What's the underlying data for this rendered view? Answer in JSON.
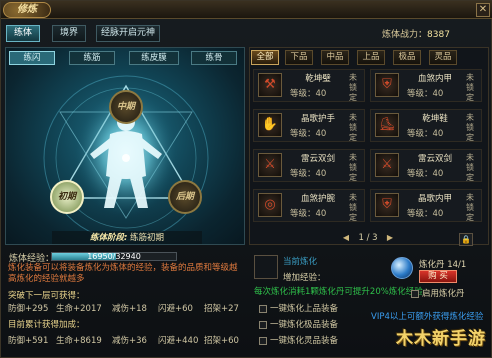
{
  "window": {
    "title": "修炼",
    "close_label": "✕"
  },
  "tabs": [
    {
      "label": "练体",
      "active": true
    },
    {
      "label": "境界",
      "active": false
    },
    {
      "label": "经脉开启元神",
      "active": false
    }
  ],
  "power": {
    "label": "炼体战力：",
    "value": "8387"
  },
  "subtabs": [
    {
      "label": "练闪",
      "active": true
    },
    {
      "label": "练筋",
      "active": false
    },
    {
      "label": "练皮膜",
      "active": false
    },
    {
      "label": "练骨",
      "active": false
    }
  ],
  "nodes": {
    "top": "中期",
    "left": "初期",
    "right": "后期"
  },
  "stage_caption": {
    "highlight": "练体阶段:",
    "text": "练筋初期"
  },
  "exp": {
    "label": "炼体经验：",
    "current": 16950,
    "max": 32940,
    "text": "16950/32940"
  },
  "description": "炼化装备可以将装备炼化为炼体的经验，装备的品质和等级越高炼化的经验就越多",
  "next_gain": {
    "title": "突破下一层可获得：",
    "stats": [
      {
        "label": "防御",
        "value": "+295"
      },
      {
        "label": "生命",
        "value": "+2017"
      },
      {
        "label": "减伤",
        "value": "+18"
      },
      {
        "label": "闪避",
        "value": "+60"
      },
      {
        "label": "招架",
        "value": "+27"
      }
    ]
  },
  "total_gain": {
    "title": "目前累计获得加成：",
    "stats": [
      {
        "label": "防御",
        "value": "+591"
      },
      {
        "label": "生命",
        "value": "+8619"
      },
      {
        "label": "减伤",
        "value": "+36"
      },
      {
        "label": "闪避",
        "value": "+440"
      },
      {
        "label": "招架",
        "value": "+60"
      }
    ]
  },
  "filter_tabs": [
    {
      "label": "全部",
      "active": true
    },
    {
      "label": "下品",
      "active": false
    },
    {
      "label": "中品",
      "active": false
    },
    {
      "label": "上品",
      "active": false
    },
    {
      "label": "极品",
      "active": false
    },
    {
      "label": "灵品",
      "active": false
    }
  ],
  "items": [
    {
      "name": "乾坤璧",
      "level_label": "等级：",
      "level": "40",
      "status": "未锁定",
      "icon": "⚒"
    },
    {
      "name": "血煞内甲",
      "level_label": "等级：",
      "level": "40",
      "status": "未锁定",
      "icon": "⛨"
    },
    {
      "name": "晶歌护手",
      "level_label": "等级：",
      "level": "40",
      "status": "未锁定",
      "icon": "✋"
    },
    {
      "name": "乾坤鞋",
      "level_label": "等级：",
      "level": "40",
      "status": "未锁定",
      "icon": "⛸"
    },
    {
      "name": "雷云双剑",
      "level_label": "等级：",
      "level": "40",
      "status": "未锁定",
      "icon": "⚔"
    },
    {
      "name": "雷云双剑",
      "level_label": "等级：",
      "level": "40",
      "status": "未锁定",
      "icon": "⚔"
    },
    {
      "name": "血煞护腕",
      "level_label": "等级：",
      "level": "40",
      "status": "未锁定",
      "icon": "◎"
    },
    {
      "name": "晶歌内甲",
      "level_label": "等级：",
      "level": "40",
      "status": "未锁定",
      "icon": "⛨"
    }
  ],
  "pager": {
    "text": "1 / 3",
    "prev": "◀",
    "next": "▶"
  },
  "lock_icon_glyph": "🔒",
  "refine": {
    "current_label": "当前炼化",
    "increase_label": "增加经验：",
    "note": "每次炼化消耗1颗炼化丹可提升20%炼化经验",
    "pill_label": "炼化丹",
    "pill_count": "14/1",
    "button": "购 买",
    "use_pill": "启用炼化丹"
  },
  "options": [
    {
      "label": "一键炼化上品装备"
    },
    {
      "label": "一键炼化极品装备"
    },
    {
      "label": "一键炼化灵品装备"
    }
  ],
  "vip": "VIP4以上可额外获得炼化经验",
  "watermark": "木木新手游",
  "colors": {
    "accent": "#69b4c4",
    "warning": "#e07a3e",
    "good": "#2fbf4a",
    "buy": "#d8342a"
  }
}
